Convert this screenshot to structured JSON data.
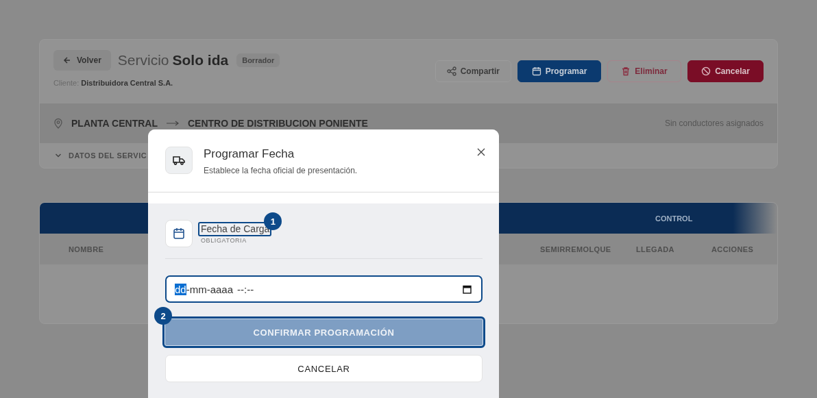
{
  "page": {
    "back_button": "Volver",
    "title_prefix": "Servicio",
    "title": "Solo ida",
    "status_badge": "Borrador",
    "client_label": "Cliente:",
    "client": "Distribuidora Central S.A.",
    "actions": [
      {
        "kind": "share",
        "label": "Compartir"
      },
      {
        "kind": "schedule",
        "label": "Programar"
      },
      {
        "kind": "delete",
        "label": "Eliminar"
      },
      {
        "kind": "cancel",
        "label": "Cancelar"
      }
    ],
    "route": {
      "origin": "PLANTA CENTRAL",
      "destination": "CENTRO DE DISTRIBUCION PONIENTE",
      "drivers": "Sin conductores asignados"
    },
    "details_toggle": "DATOS DEL SERVIC"
  },
  "table": {
    "group_header": "CONTROL",
    "columns": [
      "NOMBRE",
      "SEMIRREMOLQUE",
      "LLEGADA",
      "ACCIONES"
    ]
  },
  "modal": {
    "title": "Programar Fecha",
    "subtitle": "Establece la fecha oficial de presentación.",
    "field": {
      "label": "Fecha de Carga",
      "hint": "OBLIGATORIA",
      "annotation_badge": "1"
    },
    "date_input": {
      "parts": [
        {
          "text": "dd",
          "selected": true
        },
        {
          "text": "-mm-aaaa",
          "selected": false
        },
        {
          "text": "--:--",
          "selected": false
        }
      ]
    },
    "confirm_button": {
      "label": "CONFIRMAR PROGRAMACIÓN",
      "disabled": true,
      "annotation_badge": "2"
    },
    "cancel_button": "CANCELAR"
  }
}
